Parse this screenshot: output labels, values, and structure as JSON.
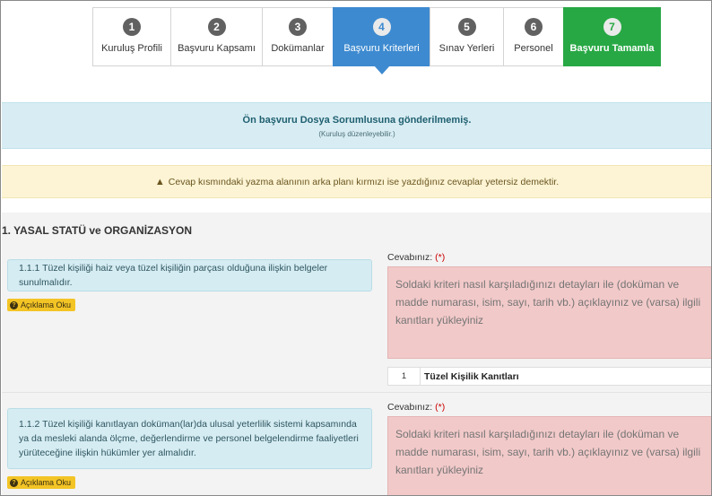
{
  "steps": [
    {
      "num": "1",
      "label": "Kuruluş Profili",
      "state": "default"
    },
    {
      "num": "2",
      "label": "Başvuru Kapsamı",
      "state": "default"
    },
    {
      "num": "3",
      "label": "Dokümanlar",
      "state": "default"
    },
    {
      "num": "4",
      "label": "Başvuru Kriterleri",
      "state": "active"
    },
    {
      "num": "5",
      "label": "Sınav Yerleri",
      "state": "default"
    },
    {
      "num": "6",
      "label": "Personel",
      "state": "default"
    },
    {
      "num": "7",
      "label": "Başvuru Tamamla",
      "state": "done"
    }
  ],
  "info_alert": {
    "title": "Ön başvuru Dosya Sorumlusuna gönderilmemiş.",
    "subtitle": "(Kuruluş düzenleyebilir.)"
  },
  "warning_alert": {
    "icon": "warning-triangle-icon",
    "text": "Cevap kısmındaki yazma alanının arka planı kırmızı ise yazdığınız cevaplar yetersiz demektir."
  },
  "section": {
    "title": "1. YASAL STATÜ ve ORGANİZASYON",
    "criteria": [
      {
        "text": "1.1.1 Tüzel kişiliği haiz veya tüzel kişiliğin parçası olduğuna ilişkin belgeler sunulmalıdır.",
        "read_button": "Açıklama Oku",
        "answer_label": "Cevabınız:",
        "required_mark": "(*)",
        "answer_placeholder": "Soldaki kriteri nasıl karşıladığınızı detayları ile (doküman ve madde numarası, isim, sayı, tarih vb.) açıklayınız ve (varsa) ilgili kanıtları yükleyiniz",
        "evidence": {
          "index": "1",
          "name": "Tüzel Kişilik Kanıtları"
        }
      },
      {
        "text": "1.1.2 Tüzel kişiliği kanıtlayan doküman(lar)da ulusal yeterlilik sistemi kapsamında ya da mesleki alanda ölçme, değerlendirme ve personel belgelendirme faaliyetleri yürüteceğine ilişkin hükümler yer almalıdır.",
        "read_button": "Açıklama Oku",
        "answer_label": "Cevabınız:",
        "required_mark": "(*)",
        "answer_placeholder": "Soldaki kriteri nasıl karşıladığınızı detayları ile (doküman ve madde numarası, isim, sayı, tarih vb.) açıklayınız ve (varsa) ilgili kanıtları yükleyiniz"
      }
    ]
  },
  "colors": {
    "active_step": "#3d8ad0",
    "done_step": "#27a844",
    "answer_insufficient_bg": "#f2c9c9"
  }
}
